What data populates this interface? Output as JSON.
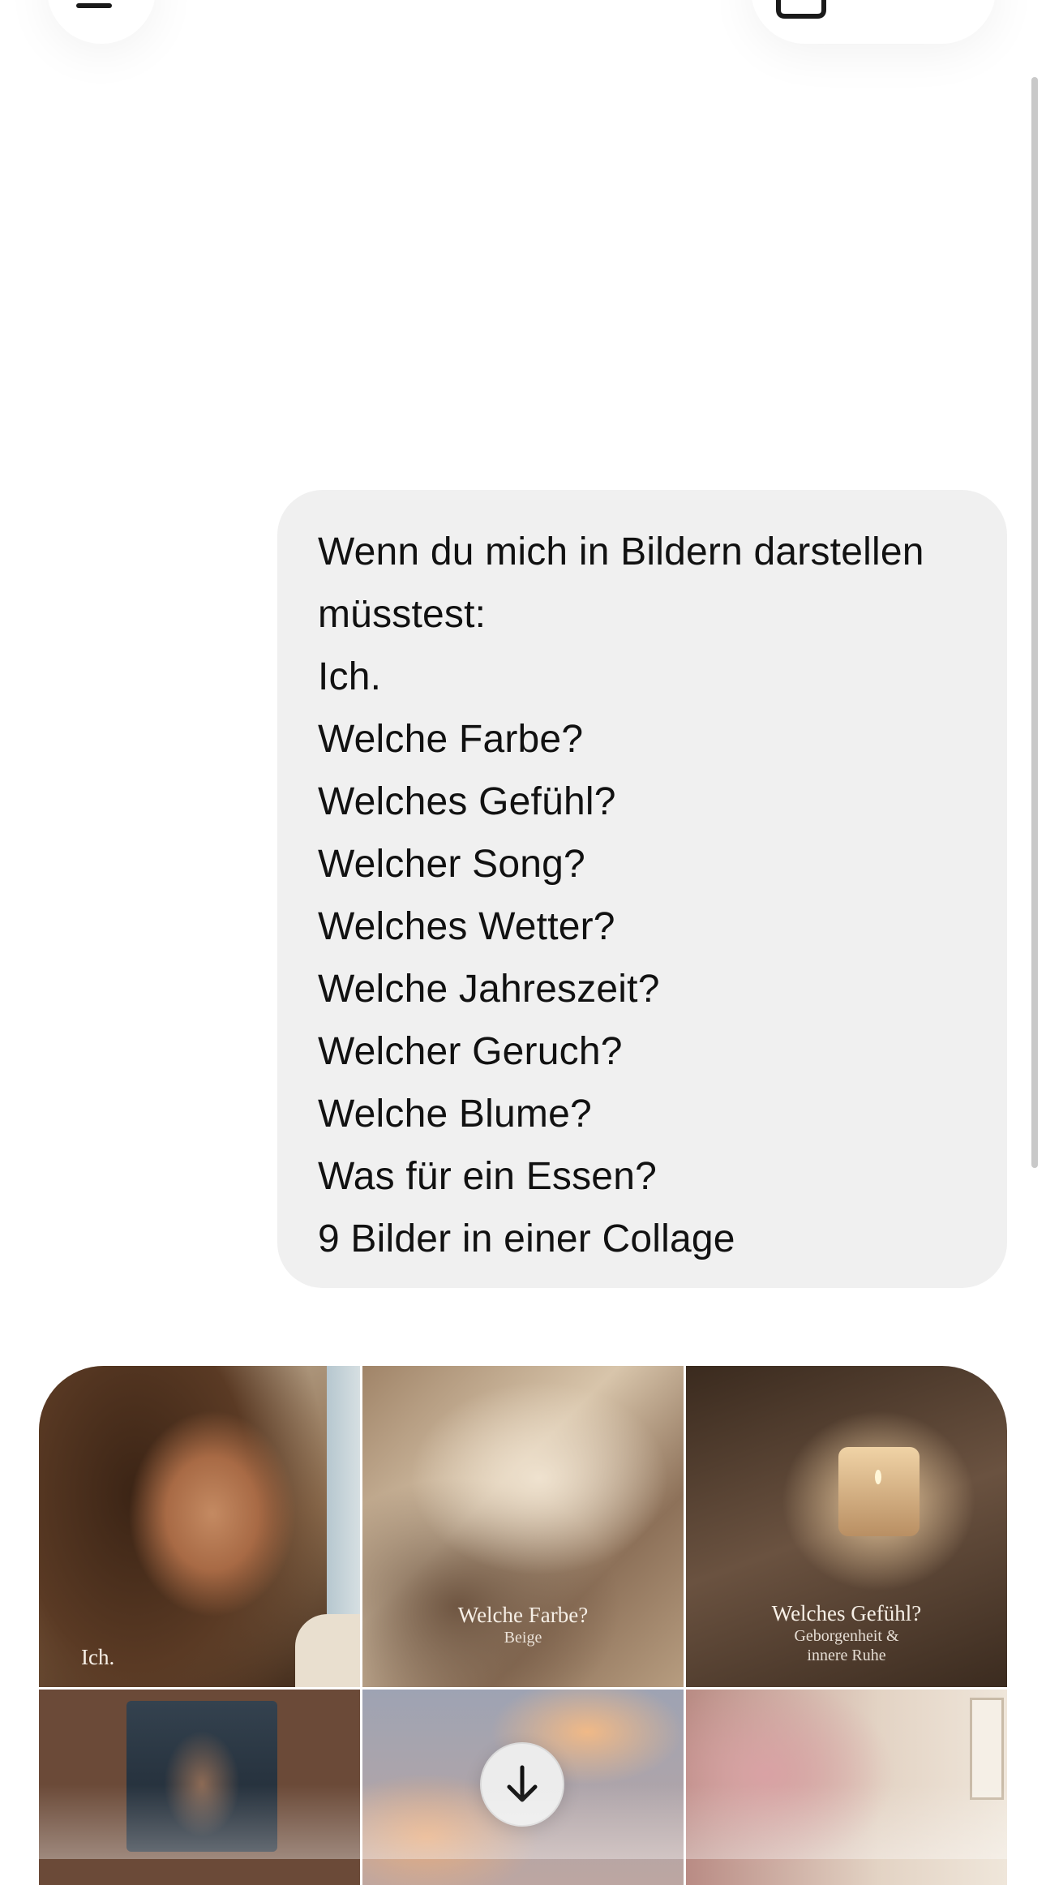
{
  "header": {
    "menu_icon": "menu-icon",
    "new_chat_icon": "new-chat-icon"
  },
  "message": {
    "lines": [
      "Wenn du mich in Bildern darstellen",
      "müsstest:",
      "Ich.",
      "Welche Farbe?",
      "Welches Gefühl?",
      "Welcher Song?",
      "Welches Wetter?",
      "Welche Jahreszeit?",
      "Welcher Geruch?",
      "Welche Blume?",
      "Was für ein Essen?",
      "9 Bilder in einer Collage"
    ]
  },
  "collage": {
    "tiles": [
      {
        "title": "Ich.",
        "subtitle": ""
      },
      {
        "title": "Welche Farbe?",
        "subtitle": "Beige"
      },
      {
        "title": "Welches Gefühl?",
        "subtitle": "Geborgenheit &",
        "subtitle2": "innere Ruhe"
      }
    ]
  },
  "scroll_button_icon": "arrow-down-icon"
}
